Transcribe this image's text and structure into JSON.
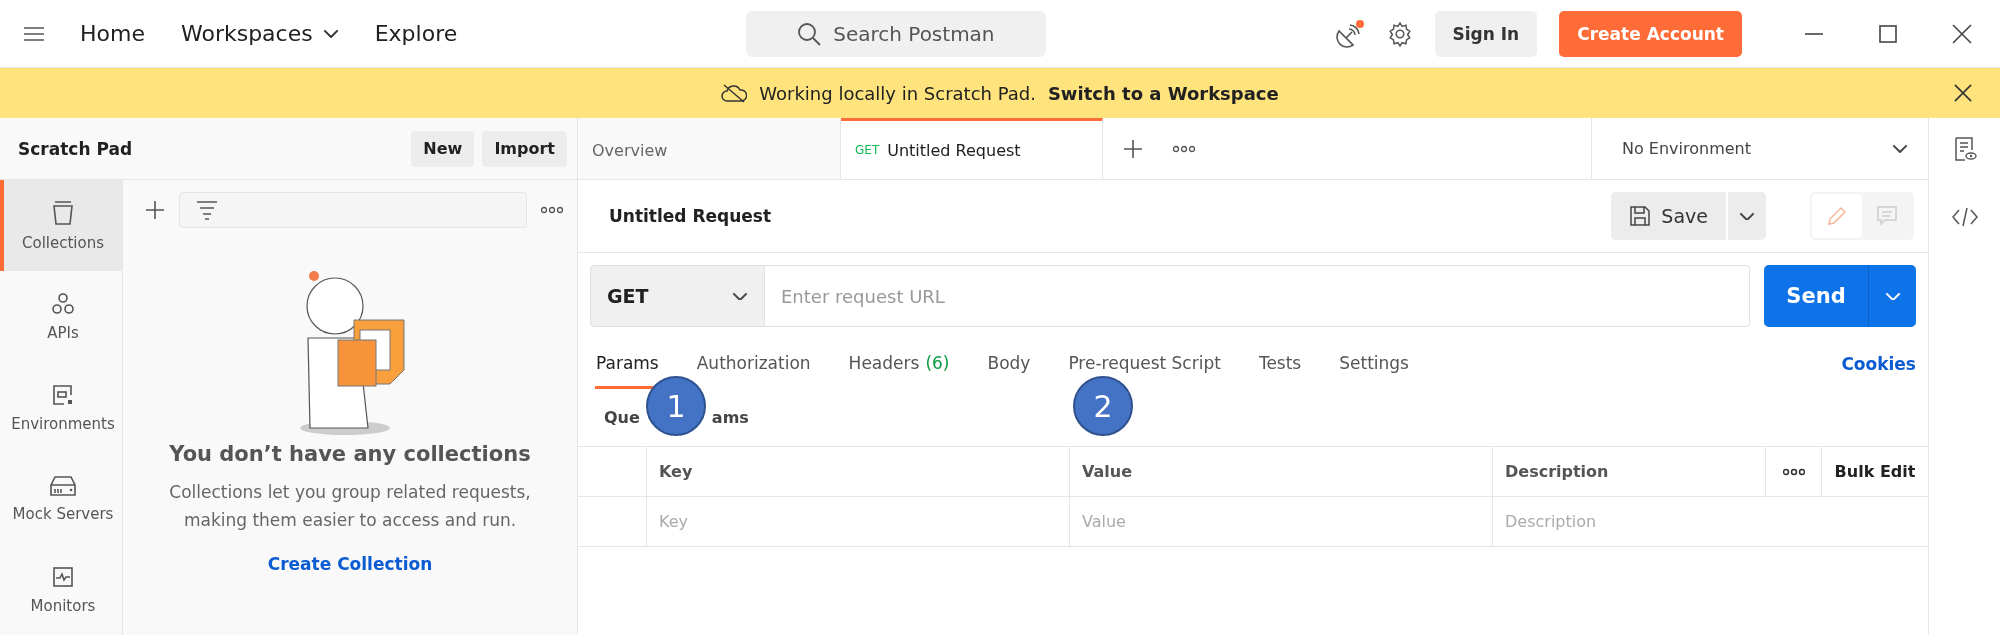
{
  "top_bar": {
    "nav": [
      {
        "label": "Home",
        "has_menu": false
      },
      {
        "label": "Workspaces",
        "has_menu": true
      },
      {
        "label": "Explore",
        "has_menu": false
      }
    ],
    "search": {
      "placeholder": "Search Postman"
    },
    "sync_unread": true,
    "sign_in": "Sign In",
    "create_account": "Create Account"
  },
  "banner": {
    "text": "Working locally in Scratch Pad.",
    "link": "Switch to a Workspace"
  },
  "sidebar": {
    "title": "Scratch Pad",
    "buttons": [
      "New",
      "Import"
    ],
    "items": [
      {
        "label": "Collections",
        "kind": "collections",
        "selected": true
      },
      {
        "label": "APIs",
        "kind": "apis",
        "selected": false
      },
      {
        "label": "Environments",
        "kind": "environments",
        "selected": false
      },
      {
        "label": "Mock Servers",
        "kind": "mock",
        "selected": false
      },
      {
        "label": "Monitors",
        "kind": "monitors",
        "selected": false
      }
    ]
  },
  "collections_panel": {
    "empty_title": "You don’t have any collections",
    "empty_text": "Collections let you group related requests, making them easier to access and run.",
    "action": "Create Collection"
  },
  "tabs": [
    {
      "label": "Overview",
      "selected": false
    },
    {
      "method": "GET",
      "label": "Untitled Request",
      "selected": true
    }
  ],
  "environment": "No Environment",
  "request": {
    "title": "Untitled Request",
    "save": "Save",
    "method": "GET",
    "url_placeholder": "Enter request URL",
    "send": "Send",
    "tabs": [
      {
        "label": "Params",
        "selected": true
      },
      {
        "label": "Authorization",
        "selected": false
      },
      {
        "label": "Headers",
        "count": "(6)",
        "selected": false
      },
      {
        "label": "Body",
        "selected": false
      },
      {
        "label": "Pre-request Script",
        "selected": false
      },
      {
        "label": "Tests",
        "selected": false
      },
      {
        "label": "Settings",
        "selected": false
      }
    ],
    "cookies": "Cookies",
    "section": {
      "visible_start": "Que",
      "visible_end": "ams"
    },
    "table": {
      "columns": [
        "Key",
        "Value",
        "Description"
      ],
      "bulk_edit": "Bulk Edit",
      "rows": [
        {
          "key_placeholder": "Key",
          "value_placeholder": "Value",
          "description_placeholder": "Description"
        }
      ]
    }
  },
  "callouts": [
    "1",
    "2"
  ]
}
